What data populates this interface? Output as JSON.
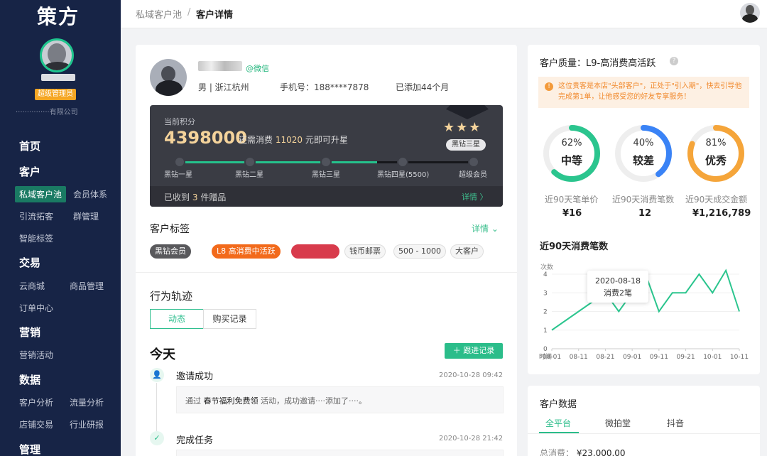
{
  "sidebar": {
    "logo": "策方",
    "admin_badge": "超级管理员",
    "company": "···············有限公司",
    "nav": [
      {
        "id": "home",
        "label": "首页"
      },
      {
        "id": "customer",
        "label": "客户"
      },
      {
        "id": "trade",
        "label": "交易"
      },
      {
        "id": "marketing",
        "label": "营销"
      },
      {
        "id": "data",
        "label": "数据"
      },
      {
        "id": "manage",
        "label": "管理"
      }
    ],
    "items": {
      "private_pool": "私域客户池",
      "member_system": "会员体系",
      "traffic": "引流拓客",
      "groups": "群管理",
      "smart_tags": "智能标签",
      "cloud_mall": "云商城",
      "products": "商品管理",
      "orders": "订单中心",
      "campaigns": "营销活动",
      "cust_analysis": "客户分析",
      "traffic_analysis": "流量分析",
      "store_trade": "店铺交易",
      "industry": "行业研报"
    }
  },
  "topbar": {
    "crumb_parent": "私域客户池",
    "crumb_sep": "/",
    "crumb_current": "客户详情"
  },
  "customer": {
    "source": "@微信",
    "gender_location": "男 | 浙江杭州",
    "phone": "手机号：188****7878",
    "added": "已添加44个月"
  },
  "vip": {
    "points_label": "当前积分",
    "points": "4398000",
    "upgrade_pre": "还需消费",
    "upgrade_amount": "11020",
    "upgrade_post": "元即可升星",
    "stars": "★★★",
    "rank": "黑钻三星",
    "levels": [
      "黑钻一星",
      "黑钻二星",
      "黑钻三星",
      "黑钻四星(5500)",
      "超级会员"
    ],
    "progress": 0.67,
    "gifts_pre": "已收到",
    "gifts_count": "3",
    "gifts_post": "件赠品",
    "detail": "详情 〉"
  },
  "tags": {
    "title": "客户标签",
    "detail": "详情 ⌄",
    "items": [
      "黑钻会员",
      "L8 高消费中活跃",
      "·········",
      "钱币邮票",
      "500 - 1000",
      "大客户"
    ]
  },
  "behavior": {
    "title": "行为轨迹",
    "tabs": [
      "动态",
      "购买记录"
    ],
    "today": "今天",
    "follow_btn": "＋ 跟进记录",
    "events": [
      {
        "title": "邀请成功",
        "time": "2020-10-28 09:42",
        "desc_pre": "通过",
        "desc_bold": "春节福利免费领",
        "desc_post": "活动，成功邀请····添加了····。"
      },
      {
        "title": "完成任务",
        "time": "2020-10-28 21:42"
      }
    ]
  },
  "quality": {
    "title": "客户质量：L9-高消费高活跃",
    "help": "?",
    "alert_icon": "!",
    "alert": "这位贵客是本店\"头部客户\"，正处于\"引入期\"，快去引导他完成第1单，让他感受您的好友专享服务！",
    "gauges": [
      {
        "pct": "62%",
        "value": 62,
        "level": "中等",
        "color": "#2bc58e",
        "metric_label": "近90天笔单价",
        "metric_value": "¥16"
      },
      {
        "pct": "40%",
        "value": 40,
        "level": "较差",
        "color": "#3a83f6",
        "metric_label": "近90天消费笔数",
        "metric_value": "12"
      },
      {
        "pct": "81%",
        "value": 81,
        "level": "优秀",
        "color": "#f5a53a",
        "metric_label": "近90天成交金额",
        "metric_value": "¥1,216,789"
      }
    ]
  },
  "chart_title": "近90天消费笔数",
  "chart_data": {
    "type": "line",
    "ylabel": "次数",
    "xlabel": "时间",
    "categories": [
      "08-01",
      "08-11",
      "08-21",
      "09-01",
      "09-11",
      "09-21",
      "10-01",
      "10-11"
    ],
    "x": [
      0,
      0.5,
      1,
      1.5,
      2,
      2.5,
      3,
      3.5,
      4,
      4.5,
      5,
      5.5,
      6,
      6.5,
      7
    ],
    "y": [
      1,
      1.5,
      2,
      2.5,
      3,
      2,
      3,
      4,
      2,
      3,
      3,
      4,
      3,
      4.2,
      2
    ],
    "ylim": [
      0,
      4
    ],
    "yticks": [
      0,
      1,
      2,
      3,
      4
    ],
    "color": "#2bc58e",
    "highlight_index": 4,
    "tooltip_date": "2020-08-18",
    "tooltip_value": "消费2笔"
  },
  "data_card": {
    "title": "客户数据",
    "tabs": [
      "全平台",
      "微拍堂",
      "抖音"
    ],
    "total_label": "总消费：",
    "total_value": "¥23,000.00"
  }
}
